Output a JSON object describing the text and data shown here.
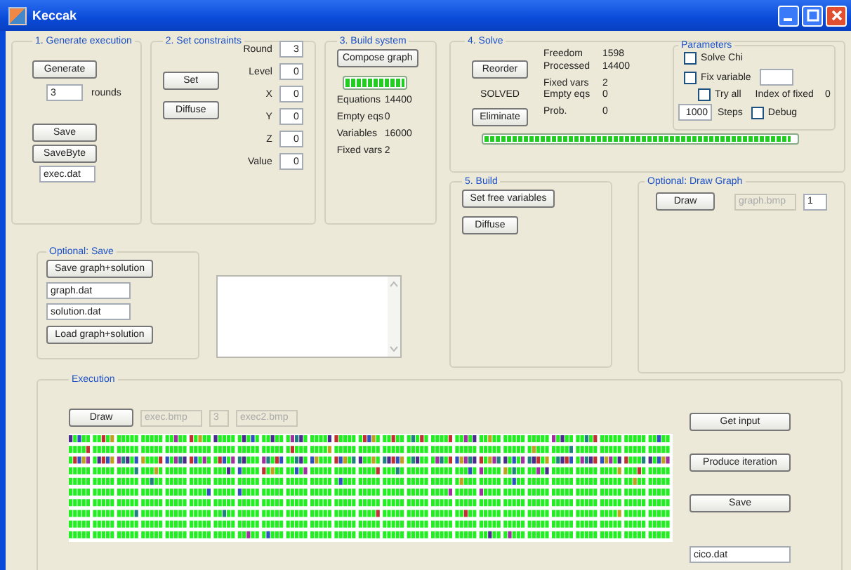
{
  "window": {
    "title": "Keccak"
  },
  "generate": {
    "title": "1. Generate execution",
    "generate_button": "Generate",
    "rounds_value": "3",
    "rounds_label": "rounds",
    "save_button": "Save",
    "savebyte_button": "SaveByte",
    "file": "exec.dat"
  },
  "constraints": {
    "title": "2. Set constraints",
    "set_button": "Set",
    "diffuse_button": "Diffuse",
    "fields": [
      {
        "label": "Round",
        "value": "3"
      },
      {
        "label": "Level",
        "value": "0"
      },
      {
        "label": "X",
        "value": "0"
      },
      {
        "label": "Y",
        "value": "0"
      },
      {
        "label": "Z",
        "value": "0"
      },
      {
        "label": "Value",
        "value": "0"
      }
    ]
  },
  "build_system": {
    "title": "3. Build system",
    "compose_button": "Compose graph",
    "progress": {
      "level": 1
    },
    "stats": [
      {
        "label": "Equations",
        "value": "14400"
      },
      {
        "label": "Empty eqs",
        "value": "0"
      },
      {
        "label": "Variables",
        "value": "16000"
      },
      {
        "label": "Fixed vars",
        "value": "2"
      }
    ]
  },
  "solve": {
    "title": "4. Solve",
    "reorder_button": "Reorder",
    "status": "SOLVED",
    "eliminate_button": "Eliminate",
    "stats": [
      {
        "label": "Freedom",
        "value": "1598"
      },
      {
        "label": "Processed",
        "value": "14400"
      },
      {
        "label": "Fixed vars",
        "value": "2"
      },
      {
        "label": "Empty eqs",
        "value": "0"
      },
      {
        "label": "Prob.",
        "value": "0"
      }
    ],
    "progress": {
      "level": 0.98
    },
    "parameters": {
      "title": "Parameters",
      "checkboxes": [
        {
          "label": "Solve Chi",
          "checked": false
        },
        {
          "label": "Fix variable",
          "checked": false
        },
        {
          "label": "Try all",
          "checked": false
        },
        {
          "label": "Debug",
          "checked": false
        }
      ],
      "index_label": "Index of fixed",
      "index_value": "0",
      "steps_value": "1000",
      "steps_label": "Steps"
    }
  },
  "build": {
    "title": "5. Build",
    "buttons": [
      "Set free variables",
      "Diffuse"
    ]
  },
  "draw_graph": {
    "title": "Optional: Draw Graph",
    "draw_button": "Draw",
    "fields": [
      {
        "value": "graph.bmp",
        "disabled": true
      },
      {
        "value": "1",
        "disabled": false
      }
    ]
  },
  "optional_save": {
    "title": "Optional: Save",
    "save_button": "Save graph+solution",
    "fields": [
      "graph.dat",
      "solution.dat"
    ],
    "load_button": "Load graph+solution"
  },
  "execution": {
    "title": "Execution",
    "draw_button": "Draw",
    "fields": [
      {
        "value": "exec.bmp",
        "disabled": true
      },
      {
        "value": "3",
        "disabled": true
      },
      {
        "value": "exec2.bmp",
        "disabled": true
      }
    ],
    "buttons": [
      "Get input",
      "Produce iteration",
      "Save"
    ],
    "file": "cico.dat"
  }
}
